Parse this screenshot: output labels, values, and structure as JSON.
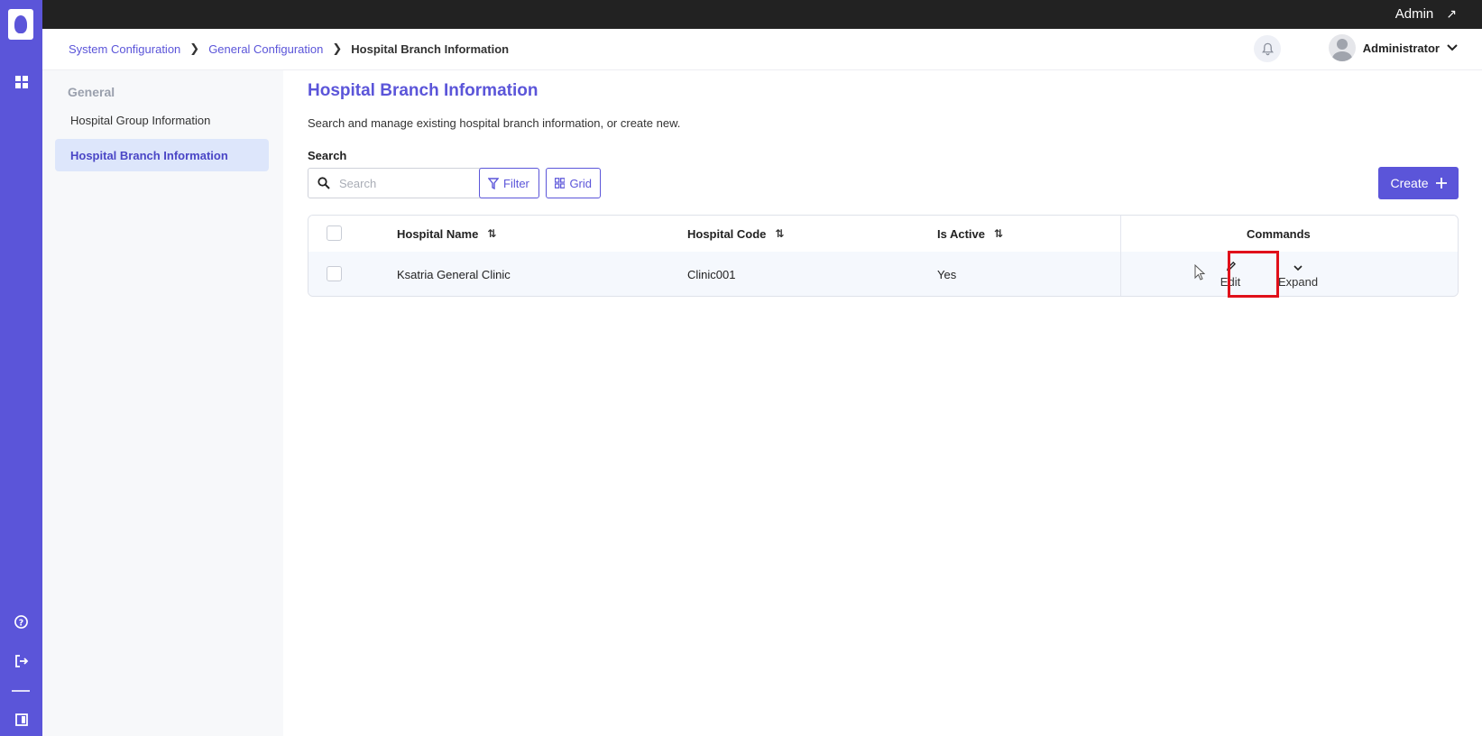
{
  "topbar": {
    "admin_link": "Admin",
    "admin_arrow_icon": "external-arrow-icon"
  },
  "rail": {
    "icons": [
      "logo-icon",
      "apps-grid-icon",
      "help-icon",
      "logout-icon",
      "panel-icon"
    ]
  },
  "header": {
    "breadcrumb": [
      "System Configuration",
      "General Configuration",
      "Hospital Branch Information"
    ],
    "user_name": "Administrator"
  },
  "sidebar": {
    "section_title": "General",
    "items": [
      {
        "label": "Hospital Group Information",
        "active": false
      },
      {
        "label": "Hospital Branch Information",
        "active": true
      }
    ]
  },
  "main": {
    "title": "Hospital Branch Information",
    "description": "Search and manage existing hospital branch information, or create new.",
    "search_label": "Search",
    "search_placeholder": "Search",
    "search_value": "",
    "filter_label": "Filter",
    "grid_label": "Grid",
    "create_label": "Create"
  },
  "table": {
    "columns": [
      "Hospital Name",
      "Hospital Code",
      "Is Active",
      "Commands"
    ],
    "rows": [
      {
        "name": "Ksatria General Clinic",
        "code": "Clinic001",
        "active": "Yes"
      }
    ],
    "commands": {
      "edit": "Edit",
      "expand": "Expand"
    }
  },
  "colors": {
    "accent": "#5b55d9",
    "topbar": "#222222",
    "highlight": "#e0101a"
  }
}
